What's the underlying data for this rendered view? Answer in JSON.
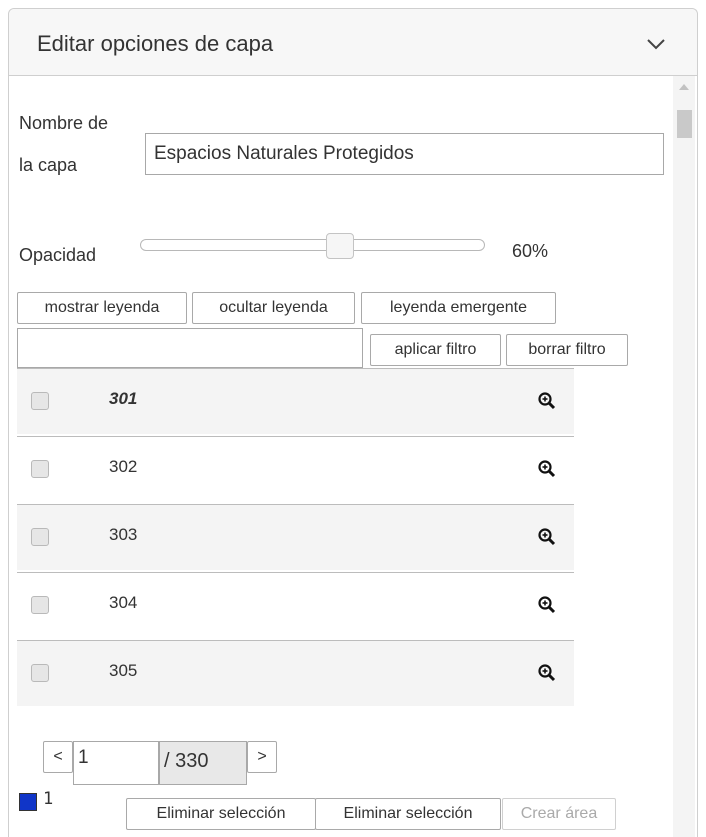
{
  "panel": {
    "title": "Editar opciones de capa"
  },
  "layer": {
    "name_label_line1": "Nombre de",
    "name_label_line2": "la capa",
    "name_value": "Espacios Naturales Protegidos"
  },
  "opacity": {
    "label": "Opacidad",
    "value": 60,
    "value_label": "60%"
  },
  "buttons": {
    "show_legend": "mostrar leyenda",
    "hide_legend": "ocultar leyenda",
    "popup_legend": "leyenda emergente",
    "apply_filter": "aplicar filtro",
    "clear_filter": "borrar filtro"
  },
  "filter": {
    "value": ""
  },
  "features": [
    {
      "code": "301",
      "selected": false,
      "highlighted": true
    },
    {
      "code": "302",
      "selected": false,
      "highlighted": false
    },
    {
      "code": "303",
      "selected": false,
      "highlighted": false
    },
    {
      "code": "304",
      "selected": false,
      "highlighted": false
    },
    {
      "code": "305",
      "selected": false,
      "highlighted": false
    }
  ],
  "pager": {
    "prev": "<",
    "next": ">",
    "current": "1",
    "total": "/ 330"
  },
  "selection": {
    "count": "1",
    "swatch_color": "#1035c8",
    "remove_selection_1": "Eliminar selección",
    "remove_selection_2": "Eliminar selección",
    "create_area": "Crear área"
  },
  "icons": {
    "collapse": "chevron-down-icon",
    "zoom": "zoom-in-icon"
  }
}
